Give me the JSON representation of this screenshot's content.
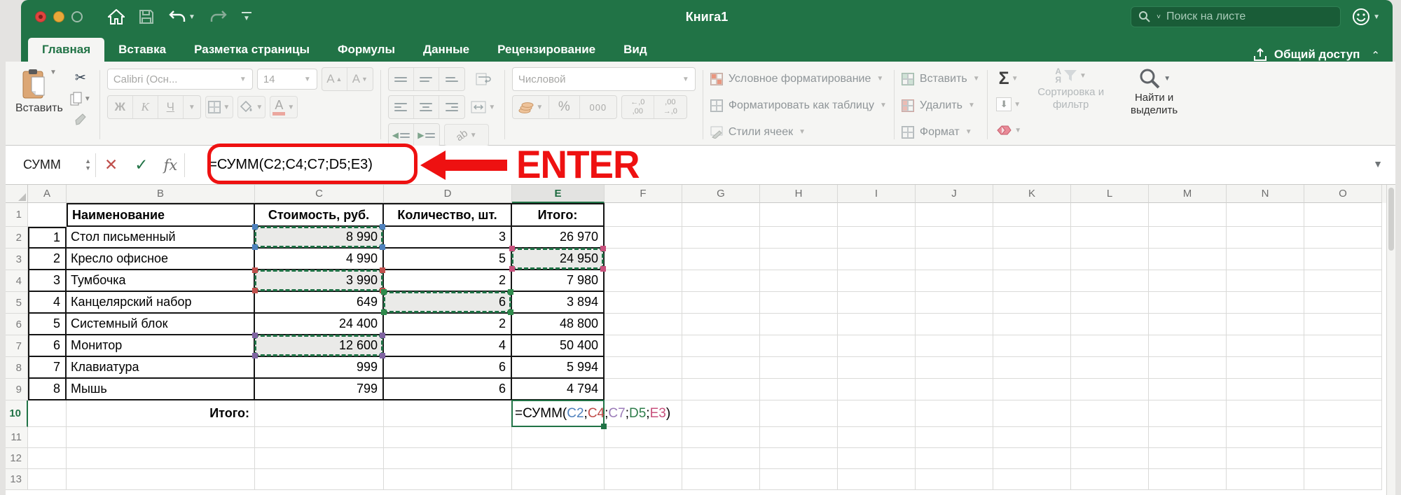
{
  "colors": {
    "excel_green": "#217346",
    "annotation_red": "#ee1111",
    "dash_green": "#1e7145"
  },
  "titlebar": {
    "title": "Книга1",
    "search_placeholder": "Поиск на листе"
  },
  "tabs": [
    {
      "label": "Главная",
      "active": true
    },
    {
      "label": "Вставка",
      "active": false
    },
    {
      "label": "Разметка страницы",
      "active": false
    },
    {
      "label": "Формулы",
      "active": false
    },
    {
      "label": "Данные",
      "active": false
    },
    {
      "label": "Рецензирование",
      "active": false
    },
    {
      "label": "Вид",
      "active": false
    }
  ],
  "share_label": "Общий доступ",
  "ribbon": {
    "paste_label": "Вставить",
    "font_name": "Calibri (Осн...",
    "font_size": "14",
    "grow_font": "A",
    "shrink_font": "A",
    "bold": "Ж",
    "italic": "К",
    "underline": "Ч",
    "font_color": "A",
    "rotate_label": "ab",
    "number_format": "Числовой",
    "percent": "%",
    "thousands": "000",
    "dec_inc_top": "←,0",
    "dec_inc_bottom": ",00",
    "dec_dec_top": ",00",
    "dec_dec_bottom": "→,0",
    "cond_format": "Условное форматирование",
    "format_table": "Форматировать как таблицу",
    "cell_styles": "Стили ячеек",
    "insert_cells": "Вставить",
    "delete_cells": "Удалить",
    "format_cells": "Формат",
    "autosum": "Σ",
    "az_top": "А",
    "az_bottom": "Я",
    "sort_filter": "Сортировка и фильтр",
    "find_select": "Найти и выделить"
  },
  "formula_bar": {
    "name_box": "СУММ",
    "formula": "=СУММ(C2;C4;C7;D5;E3)"
  },
  "annotation": {
    "label": "ENTER"
  },
  "sheet": {
    "col_headers": [
      "A",
      "B",
      "C",
      "D",
      "E",
      "F",
      "G",
      "H",
      "I",
      "J",
      "K",
      "L",
      "M",
      "N",
      "O"
    ],
    "active_col": "E",
    "active_row": "10",
    "active_cell": "E10",
    "rows": [
      {
        "n": "1",
        "A": "",
        "B": "Наименование",
        "C": "Стоимость, руб.",
        "D": "Количество, шт.",
        "E": "Итого:"
      },
      {
        "n": "2",
        "A": "1",
        "B": "Стол письменный",
        "C": "8 990",
        "D": "3",
        "E": "26 970"
      },
      {
        "n": "3",
        "A": "2",
        "B": "Кресло офисное",
        "C": "4 990",
        "D": "5",
        "E": "24 950"
      },
      {
        "n": "4",
        "A": "3",
        "B": "Тумбочка",
        "C": "3 990",
        "D": "2",
        "E": "7 980"
      },
      {
        "n": "5",
        "A": "4",
        "B": "Канцелярский набор",
        "C": "649",
        "D": "6",
        "E": "3 894"
      },
      {
        "n": "6",
        "A": "5",
        "B": "Системный блок",
        "C": "24 400",
        "D": "2",
        "E": "48 800"
      },
      {
        "n": "7",
        "A": "6",
        "B": "Монитор",
        "C": "12 600",
        "D": "4",
        "E": "50 400"
      },
      {
        "n": "8",
        "A": "7",
        "B": "Клавиатура",
        "C": "999",
        "D": "6",
        "E": "5 994"
      },
      {
        "n": "9",
        "A": "8",
        "B": "Мышь",
        "C": "799",
        "D": "6",
        "E": "4 794"
      },
      {
        "n": "10",
        "A": "",
        "B": "Итого:",
        "C": "",
        "D": "",
        "E": ""
      },
      {
        "n": "11"
      },
      {
        "n": "12"
      },
      {
        "n": "13"
      }
    ],
    "marked_cells": [
      {
        "cell": "C2",
        "handle_color": "#4f81bd"
      },
      {
        "cell": "C4",
        "handle_color": "#c0504d"
      },
      {
        "cell": "C7",
        "handle_color": "#8064a2"
      },
      {
        "cell": "D5",
        "handle_color": "#2f8a4c"
      },
      {
        "cell": "E3",
        "handle_color": "#c8517d"
      }
    ],
    "formula_parts": [
      {
        "t": "=СУММ(",
        "c": "#000000"
      },
      {
        "t": "C2",
        "c": "#4f81bd"
      },
      {
        "t": ";",
        "c": "#000000"
      },
      {
        "t": "C4",
        "c": "#bf4b48"
      },
      {
        "t": ";",
        "c": "#000000"
      },
      {
        "t": "C7",
        "c": "#9b7bb8"
      },
      {
        "t": ";",
        "c": "#000000"
      },
      {
        "t": "D5",
        "c": "#2f7d4b"
      },
      {
        "t": ";",
        "c": "#000000"
      },
      {
        "t": "E3",
        "c": "#c8517d"
      },
      {
        "t": ")",
        "c": "#000000"
      }
    ]
  }
}
